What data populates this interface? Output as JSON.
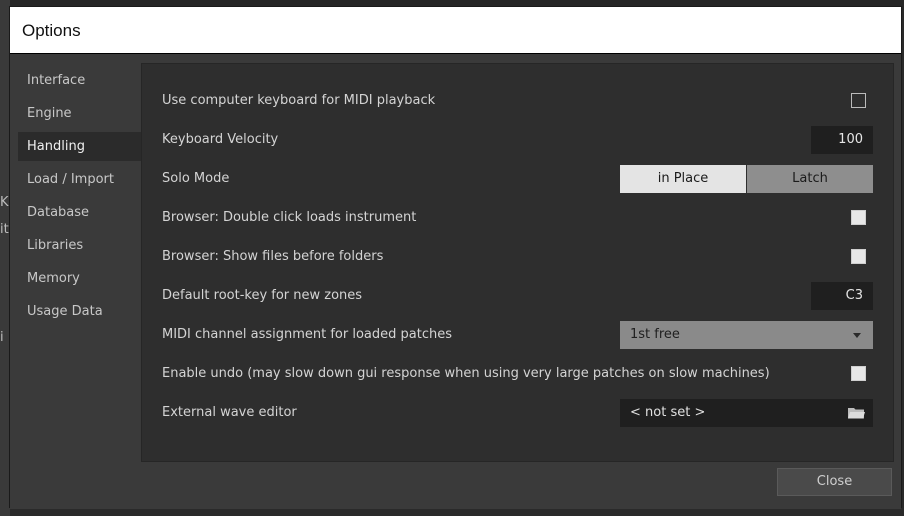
{
  "background": {
    "glyphs": [
      "K",
      "it",
      "i"
    ]
  },
  "dialog": {
    "title": "Options",
    "sidebar": {
      "items": [
        {
          "label": "Interface",
          "active": false
        },
        {
          "label": "Engine",
          "active": false
        },
        {
          "label": "Handling",
          "active": true
        },
        {
          "label": "Load / Import",
          "active": false
        },
        {
          "label": "Database",
          "active": false
        },
        {
          "label": "Libraries",
          "active": false
        },
        {
          "label": "Memory",
          "active": false
        },
        {
          "label": "Usage Data",
          "active": false
        }
      ]
    },
    "settings": {
      "midi_keyboard": {
        "label": "Use computer keyboard for MIDI playback",
        "checked": false
      },
      "velocity": {
        "label": "Keyboard Velocity",
        "value": "100"
      },
      "solo_mode": {
        "label": "Solo Mode",
        "option_a": "in Place",
        "option_b": "Latch",
        "selected": "in Place"
      },
      "double_click": {
        "label": "Browser: Double click loads instrument",
        "checked": true
      },
      "files_first": {
        "label": "Browser: Show files before folders",
        "checked": true
      },
      "root_key": {
        "label": "Default root-key for new zones",
        "value": "C3"
      },
      "midi_channel": {
        "label": "MIDI channel assignment for loaded patches",
        "value": "1st free"
      },
      "undo": {
        "label": "Enable undo (may slow down gui response when using very large patches on slow machines)",
        "checked": true
      },
      "wave_editor": {
        "label": "External wave editor",
        "value": "< not set >"
      }
    },
    "close_label": "Close"
  }
}
